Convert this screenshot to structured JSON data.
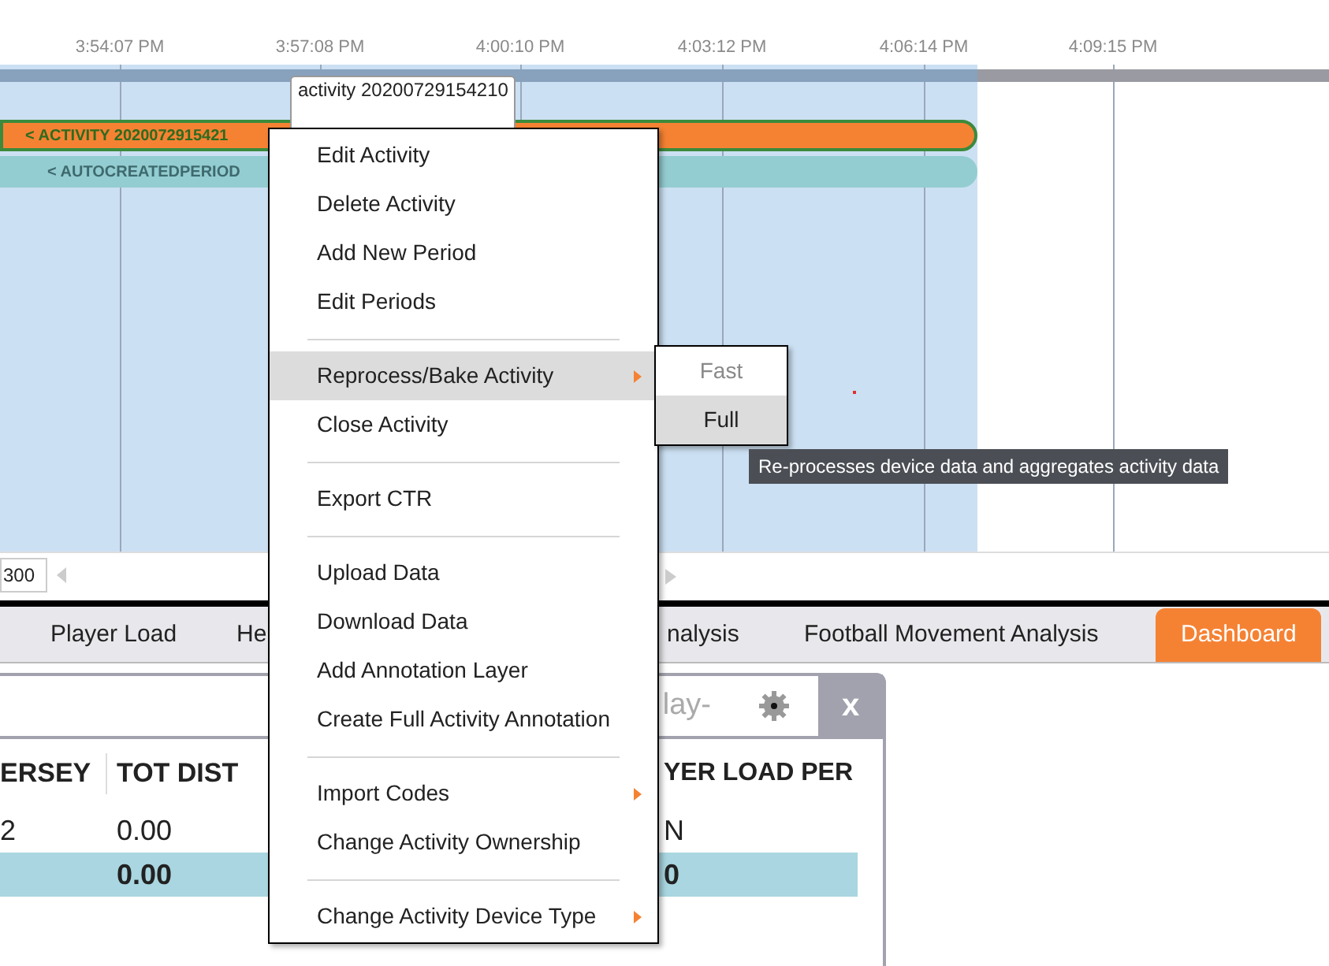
{
  "timeline": {
    "ticks": [
      "3:54:07 PM",
      "3:57:08 PM",
      "4:00:10 PM",
      "4:03:12 PM",
      "4:06:14 PM",
      "4:09:15 PM"
    ],
    "bars": [
      {
        "label": "< ACTIVITY 2020072915421",
        "color": "#f58233"
      },
      {
        "label": "< AUTOCREATEDPERIOD",
        "color": "#93cdd1"
      }
    ],
    "hover_tooltip": [
      "activity 20200729154210"
    ]
  },
  "zoom_field": {
    "value": "300"
  },
  "tabs": [
    {
      "label": "Player Load",
      "selected": false
    },
    {
      "label": "He",
      "selected": false
    },
    {
      "label": "nalysis",
      "selected": false
    },
    {
      "label": "Football Movement Analysis",
      "selected": false
    },
    {
      "label": "Dashboard",
      "selected": true
    }
  ],
  "panel": {
    "title": "lay-",
    "close": "x",
    "columns": [
      "ERSEY",
      "TOT DIST",
      "YER LOAD PER"
    ],
    "rows": [
      {
        "cells": [
          "2",
          "0.00",
          "N"
        ],
        "selected": false
      },
      {
        "cells": [
          "",
          "0.00",
          "0"
        ],
        "selected": true
      }
    ]
  },
  "context_menu": {
    "items": [
      {
        "kind": "item",
        "label": "Edit Activity",
        "selected": false
      },
      {
        "kind": "item",
        "label": "Delete Activity",
        "selected": false
      },
      {
        "kind": "item",
        "label": "Add New Period",
        "selected": false
      },
      {
        "kind": "item",
        "label": "Edit Periods",
        "selected": false
      },
      {
        "kind": "separator"
      },
      {
        "kind": "submenu",
        "label": "Reprocess/Bake Activity",
        "selected": true
      },
      {
        "kind": "item",
        "label": "Close Activity",
        "selected": false
      },
      {
        "kind": "separator"
      },
      {
        "kind": "item",
        "label": "Export CTR",
        "selected": false
      },
      {
        "kind": "separator"
      },
      {
        "kind": "item",
        "label": "Upload Data",
        "selected": false
      },
      {
        "kind": "item",
        "label": "Download Data",
        "selected": false
      },
      {
        "kind": "item",
        "label": "Add Annotation Layer",
        "selected": false
      },
      {
        "kind": "item",
        "label": "Create Full Activity Annotation",
        "selected": false
      },
      {
        "kind": "separator"
      },
      {
        "kind": "submenu",
        "label": "Import Codes",
        "selected": false
      },
      {
        "kind": "item",
        "label": "Change Activity Ownership",
        "selected": false
      },
      {
        "kind": "separator"
      },
      {
        "kind": "submenu",
        "label": "Change Activity Device Type",
        "selected": false
      }
    ]
  },
  "submenu": {
    "items": [
      {
        "label": "Fast",
        "disabled": true,
        "selected": false
      },
      {
        "label": "Full",
        "disabled": false,
        "selected": true
      }
    ]
  },
  "tooltip": "Re-processes device data and aggregates activity data"
}
